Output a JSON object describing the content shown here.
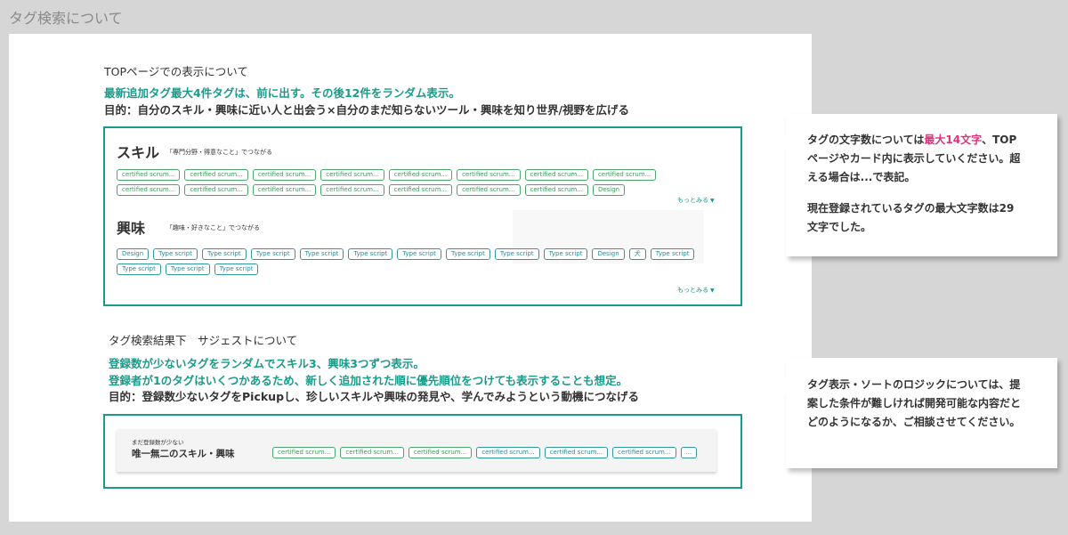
{
  "page_heading": "タグ検索について",
  "top_section": {
    "title": "TOPページでの表示について",
    "highlight": "最新追加タグ最大4件タグは、前に出す。その後12件をランダム表示。",
    "purpose": "目的：自分のスキル・興味に近い人と出会う×自分のまだ知らないツール・興味を知り世界/視野を広げる",
    "skill_block": {
      "title": "スキル",
      "desc": "「専門分野・得意なこと」でつながる",
      "tags": [
        "certified scrum...",
        "certified scrum...",
        "certified scrum...",
        "certified scrum...",
        "certified scrum...",
        "certified scrum...",
        "certified scrum...",
        "certified scrum...",
        "certified scrum...",
        "certified scrum...",
        "certified scrum...",
        "certified scrum...",
        "certified scrum...",
        "certified scrum...",
        "certified scrum...",
        "Design"
      ],
      "more": "もっとみる"
    },
    "interest_block": {
      "title": "興味",
      "desc": "「趣味・好きなこと」でつながる",
      "tags": [
        "Design",
        "Type script",
        "Type script",
        "Type script",
        "Type script",
        "Type script",
        "Type script",
        "Type script",
        "Type script",
        "Type script",
        "Design",
        "犬",
        "Type script",
        "Type script",
        "Type script",
        "Type script"
      ],
      "more": "もっとみる"
    }
  },
  "suggest_section": {
    "title": "タグ検索結果下　サジェストについて",
    "highlight_1": "登録数が少ないタグをランダムでスキル3、興味3つずつ表示。",
    "highlight_2": "登録者が1のタグはいくつかあるため、新しく追加された順に優先順位をつけても表示することも想定。",
    "purpose": "目的：登録数少ないタグをPickupし、珍しいスキルや興味の発見や、学んでみようという動機につなげる",
    "card": {
      "subtitle": "まだ登録数が少ない",
      "title": "唯一無二のスキル・興味",
      "tags_green": [
        "certified scrum...",
        "certified scrum...",
        "certified scrum..."
      ],
      "tags_blue": [
        "certified scrum...",
        "certified scrum...",
        "certified scrum..."
      ],
      "overflow": "..."
    }
  },
  "note_1": {
    "line1_a": "タグの文字数については",
    "line1_hl": "最大14文字",
    "line1_b": "、TOP",
    "line2": "ページやカード内に表示していください。超",
    "line3": "える場合は...で表記。",
    "line4": "現在登録されているタグの最大文字数は29",
    "line5": "文字でした。"
  },
  "note_2": {
    "line1": "タグ表示・ソートのロジックについては、提",
    "line2": "案した条件が難しければ開発可能な内容だと",
    "line3": "どのようになるか、ご相談させてください。"
  },
  "colors": {
    "accent_teal": "#1a9b8a",
    "highlight_pink": "#e0307c",
    "tag_green": "#4aa86b",
    "tag_blue": "#2f9ba0"
  }
}
